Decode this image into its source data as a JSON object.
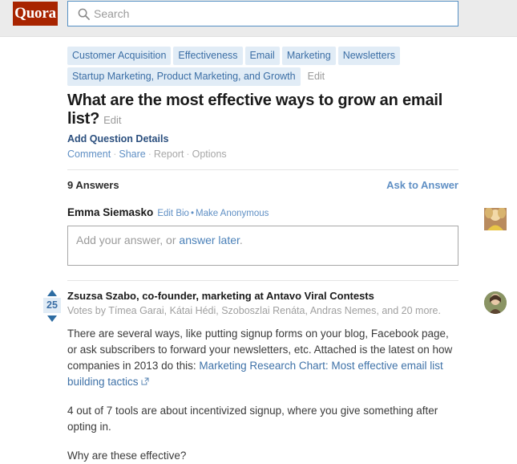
{
  "header": {
    "logo_text": "Quora",
    "logo_bg": "#a82400",
    "search_placeholder": "Search",
    "search_value": "",
    "search_icon": "search-icon"
  },
  "topics": {
    "row1": [
      "Customer Acquisition",
      "Effectiveness",
      "Email",
      "Marketing",
      "Newsletters"
    ],
    "row2": [
      "Startup Marketing, Product Marketing, and Growth"
    ],
    "edit_label": "Edit"
  },
  "question": {
    "title": "What are the most effective ways to grow an email list?",
    "edit_label": "Edit",
    "add_details_label": "Add Question Details",
    "actions": {
      "comment": "Comment",
      "share": "Share",
      "report": "Report",
      "options": "Options",
      "separator": "·"
    }
  },
  "answers_header": {
    "count_label": "9 Answers",
    "ask_to_answer_label": "Ask to Answer"
  },
  "composer": {
    "user_name": "Emma Siemasko",
    "edit_bio_label": "Edit Bio",
    "bullet": "•",
    "make_anonymous_label": "Make Anonymous",
    "placeholder_prefix": "Add your answer, or ",
    "placeholder_link": "answer later",
    "placeholder_suffix": ".",
    "avatar": "user-avatar-photo"
  },
  "answer": {
    "vote_count": "25",
    "upvote_icon": "upvote-arrow-icon",
    "downvote_icon": "downvote-arrow-icon",
    "byline": "Zsuzsa Szabo, co-founder, marketing at Antavo Viral Contests",
    "votes_by": "Votes by Tímea Garai, Kátai Hédi, Szoboszlai Renáta, Andras Nemes, and 20 more.",
    "avatar": "answerer-avatar-photo",
    "paragraph1_pre": "There are several ways, like putting signup forms on your blog, Facebook page, or ask subscribers to forward your newsletters, etc. Attached is the latest on how companies in 2013 do this: ",
    "paragraph1_link": "Marketing Research Chart: Most effective email list building tactics",
    "external_icon": "external-link-icon",
    "paragraph2": "4 out of 7 tools are about incentivized signup, where you give something after opting in.",
    "paragraph3": "Why are these effective?"
  },
  "colors": {
    "brand_red": "#a82400",
    "link_blue": "#3f72a8",
    "tag_bg": "#e1ecf6",
    "muted_gray": "#a0a0a0",
    "header_bg": "#ebebeb"
  }
}
